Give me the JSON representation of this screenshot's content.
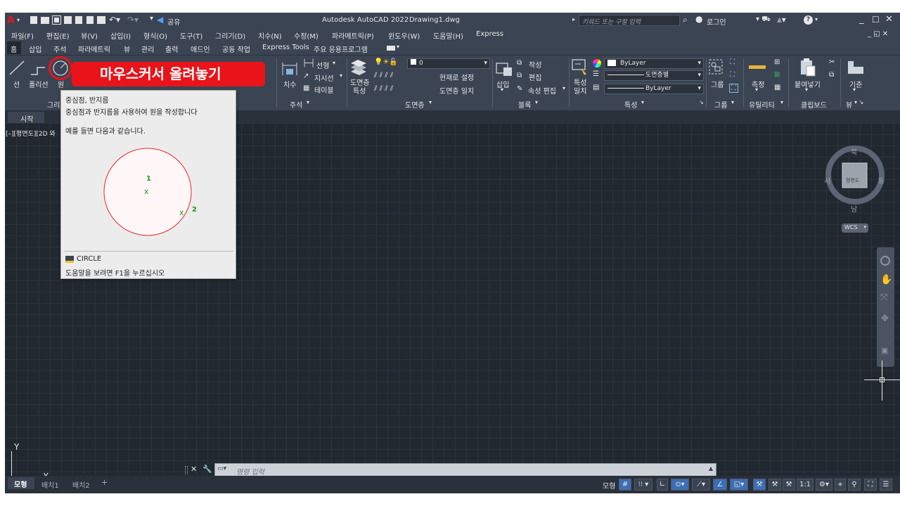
{
  "titlebar": {
    "app_title": "Autodesk AutoCAD 2022",
    "document": "Drawing1.dwg",
    "share": "공유",
    "search_placeholder": "키워드 또는 구절 입력",
    "login": "로그인"
  },
  "menubar": {
    "items": [
      "파일(F)",
      "편집(E)",
      "뷰(V)",
      "삽입(I)",
      "형식(O)",
      "도구(T)",
      "그리기(D)",
      "치수(N)",
      "수정(M)",
      "파라메트릭(P)",
      "윈도우(W)",
      "도움말(H)",
      "Express"
    ]
  },
  "ribbon_tabs": {
    "items": [
      "홈",
      "삽입",
      "주석",
      "파라메트릭",
      "뷰",
      "관리",
      "출력",
      "애드인",
      "공동 작업",
      "Express Tools",
      "주요 응용프로그램"
    ]
  },
  "ribbon": {
    "draw_panel": {
      "line": "선",
      "polyline": "폴리선",
      "circle": "원",
      "title": "그리"
    },
    "annotation_panel": {
      "dimension": "치수",
      "linear": "선형",
      "leader": "지시선",
      "table": "테이블",
      "title": "주석"
    },
    "layers_panel": {
      "layer_props_1": "도면층",
      "layer_props_2": "특성",
      "layer_value": "0",
      "set_current": "현재로 설정",
      "match_layer": "도면층 일치",
      "title": "도면층"
    },
    "block_panel": {
      "insert": "삽입",
      "create": "작성",
      "edit": "편집",
      "edit_attr": "속성 편집",
      "title": "블록"
    },
    "properties_panel": {
      "match_1": "특성",
      "match_2": "일치",
      "color": "ByLayer",
      "linetype": "도면층별",
      "lineweight": "ByLayer",
      "title": "특성"
    },
    "groups_panel": {
      "group": "그룹",
      "title": "그룹"
    },
    "utilities_panel": {
      "measure": "측정",
      "title": "유틸리티"
    },
    "clipboard_panel": {
      "paste": "붙여넣기",
      "title": "클립보드"
    },
    "view_panel": {
      "base": "기준",
      "title": "뷰"
    }
  },
  "annotation_overlay": "마우스커서 올려놓기",
  "doc_tabs": {
    "start": "시작"
  },
  "viewport_label": "[–][평면도][2D 와",
  "tooltip": {
    "title": "중심점, 반지름",
    "description": "중심점과 반지름을 사용하여 원을 작성합니다",
    "example": "예를 들면 다음과 같습니다.",
    "point1": "1",
    "point2": "2",
    "command": "CIRCLE",
    "help": "도움말을 보려면 F1을 누르십시오"
  },
  "viewcube": {
    "north": "북",
    "south": "남",
    "east": "동",
    "west": "서",
    "face": "평면도",
    "wcs": "WCS"
  },
  "ucs": {
    "x": "X",
    "y": "Y"
  },
  "command_line": {
    "placeholder": "명령 입력"
  },
  "layout_tabs": [
    "모형",
    "배치1",
    "배치2"
  ],
  "status_bar": {
    "model": "모형",
    "scale": "1:1"
  },
  "colors": {
    "accent_red": "#e8141a",
    "canvas_bg": "#212830",
    "tooltip_circle": "#e8272b",
    "point_marker": "#1a9a1a"
  }
}
